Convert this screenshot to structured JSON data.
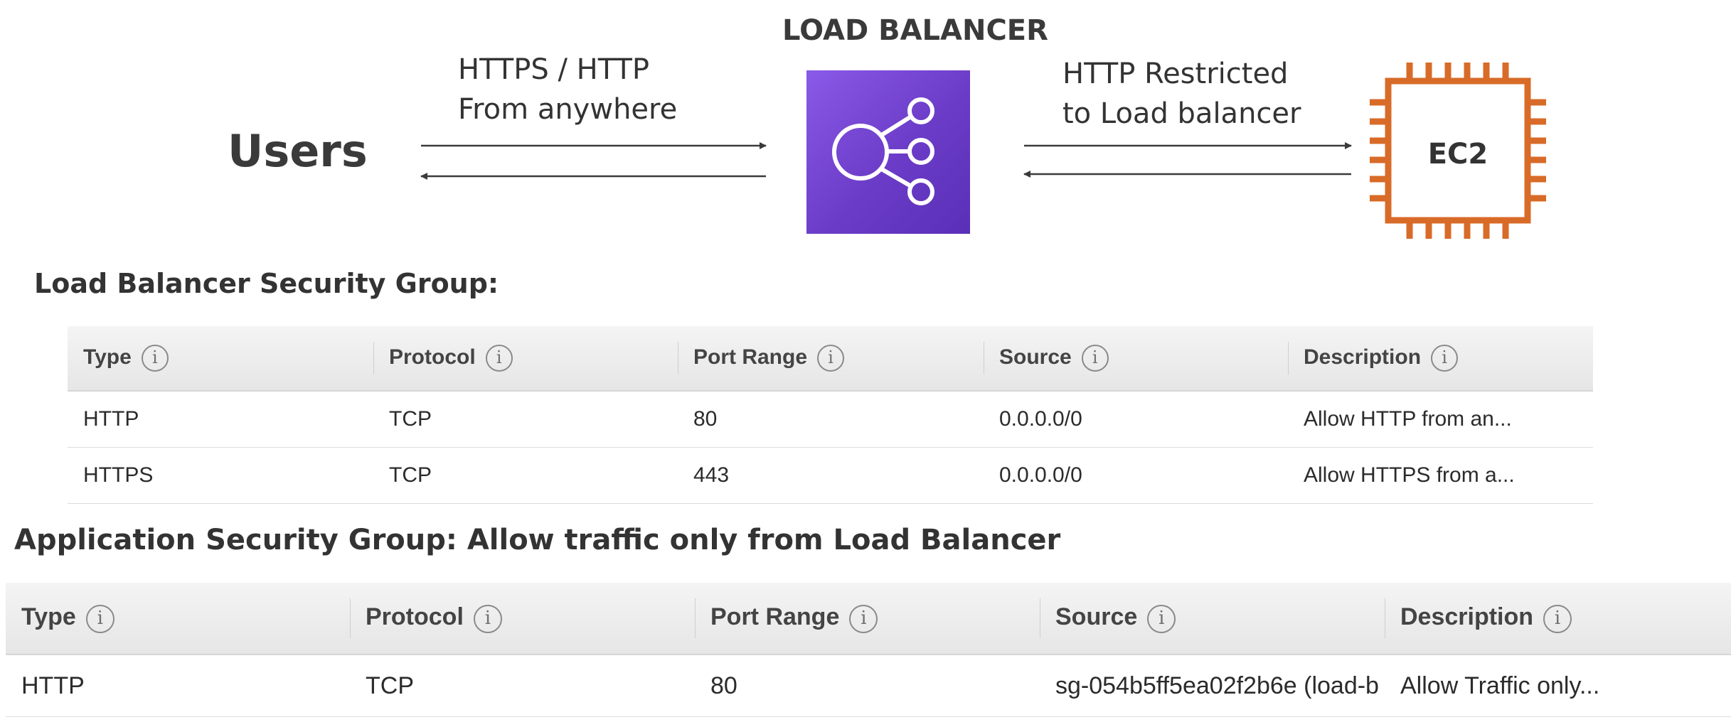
{
  "diagram": {
    "users_label": "Users",
    "lb_title": "LOAD BALANCER",
    "left_flow_line1": "HTTPS / HTTP",
    "left_flow_line2": "From anywhere",
    "right_flow_line1": "HTTP Restricted",
    "right_flow_line2": "to Load balancer",
    "ec2_label": "EC2",
    "colors": {
      "lb_purple": "#7747d6",
      "ec2_orange": "#d86b28",
      "arrow": "#3a3a3a"
    }
  },
  "lb_security_group": {
    "title": "Load Balancer Security Group:",
    "headers": [
      "Type",
      "Protocol",
      "Port Range",
      "Source",
      "Description"
    ],
    "rows": [
      [
        "HTTP",
        "TCP",
        "80",
        "0.0.0.0/0",
        "Allow HTTP from an..."
      ],
      [
        "HTTPS",
        "TCP",
        "443",
        "0.0.0.0/0",
        "Allow HTTPS from a..."
      ]
    ]
  },
  "app_security_group": {
    "title": "Application Security Group: Allow traffic only from Load Balancer",
    "headers": [
      "Type",
      "Protocol",
      "Port Range",
      "Source",
      "Description"
    ],
    "rows": [
      [
        "HTTP",
        "TCP",
        "80",
        "sg-054b5ff5ea02f2b6e (load-b",
        "Allow Traffic only..."
      ]
    ]
  },
  "info_icon_glyph": "i"
}
